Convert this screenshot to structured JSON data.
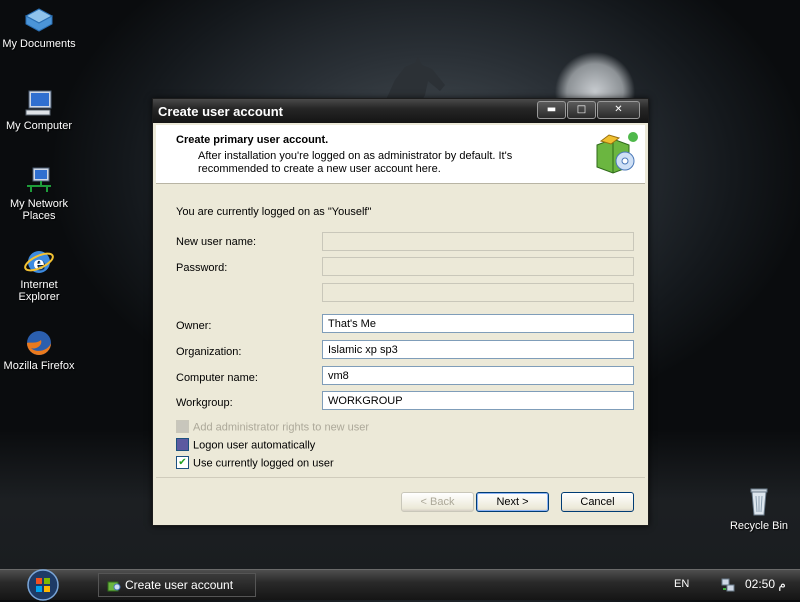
{
  "desktop": {
    "icons": [
      {
        "label": "My Documents",
        "icon": "folder-documents-icon"
      },
      {
        "label": "My Computer",
        "icon": "computer-icon"
      },
      {
        "label": "My Network Places",
        "icon": "network-icon"
      },
      {
        "label": "Internet Explorer",
        "icon": "internet-explorer-icon"
      },
      {
        "label": "Mozilla Firefox",
        "icon": "firefox-icon"
      },
      {
        "label": "Recycle Bin",
        "icon": "recycle-bin-icon"
      }
    ]
  },
  "window": {
    "title": "Create user account",
    "controls": {
      "minimize": "▬",
      "maximize": "□",
      "close": "✕"
    },
    "header": {
      "title": "Create primary user account.",
      "subtitle": "After installation you're logged on as administrator by default. It's recommended to create a new user account here."
    },
    "logged_on_text": "You are currently logged on as \"Youself\"",
    "fields": {
      "new_user_name": {
        "label": "New user name:",
        "value": ""
      },
      "password": {
        "label": "Password:",
        "value": ""
      },
      "password_confirm": {
        "value": ""
      },
      "owner": {
        "label": "Owner:",
        "value": "That's Me"
      },
      "organization": {
        "label": "Organization:",
        "value": "Islamic xp sp3"
      },
      "computer_name": {
        "label": "Computer name:",
        "value": "vm8"
      },
      "workgroup": {
        "label": "Workgroup:",
        "value": "WORKGROUP"
      }
    },
    "checkboxes": {
      "admin_rights": {
        "label": "Add administrator rights to new user",
        "checked": false,
        "enabled": false
      },
      "logon_auto": {
        "label": "Logon user automatically",
        "state": "indeterminate"
      },
      "use_current": {
        "label": "Use currently logged on user",
        "checked": true
      }
    },
    "buttons": {
      "back": "< Back",
      "next": "Next >",
      "cancel": "Cancel"
    }
  },
  "taskbar": {
    "task": "Create user account",
    "language": "EN",
    "clock": "02:50 م"
  }
}
